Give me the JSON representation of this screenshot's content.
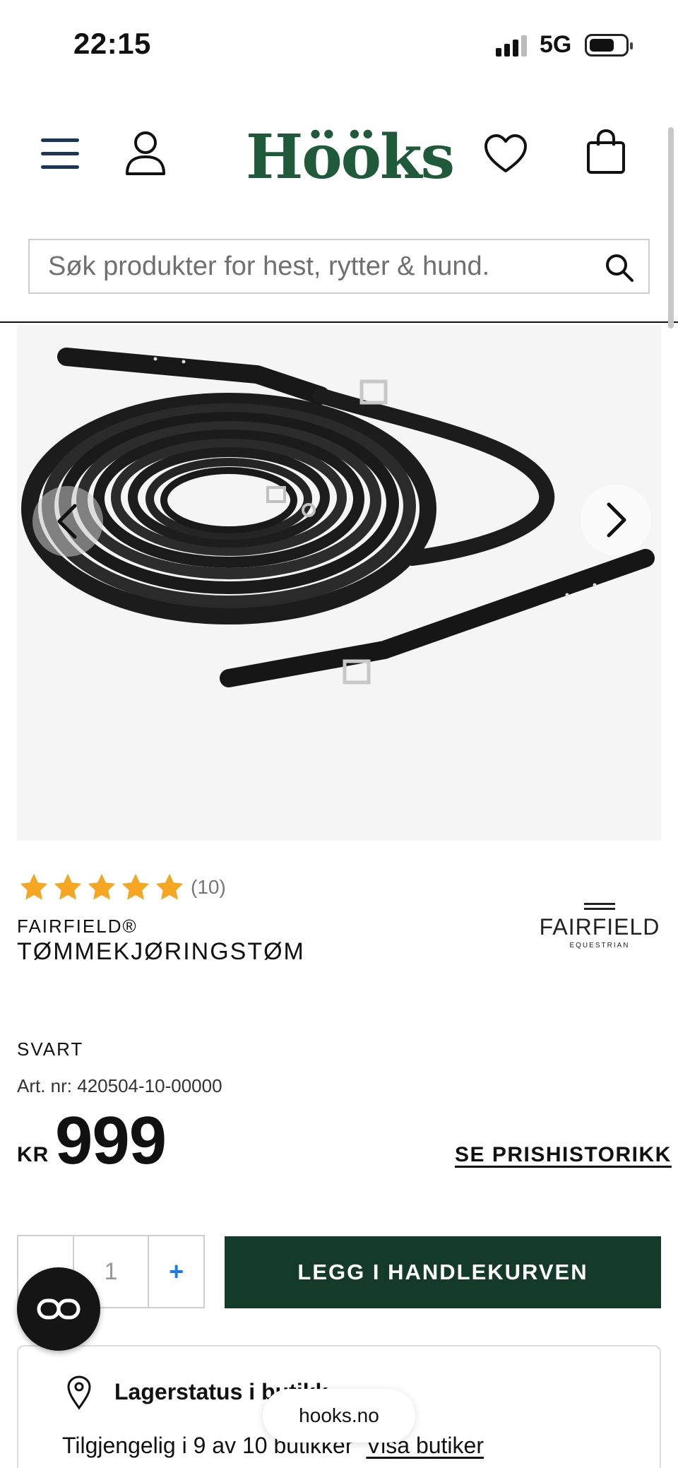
{
  "status_bar": {
    "time": "22:15",
    "network": "5G"
  },
  "header": {
    "logo": "Hööks"
  },
  "search": {
    "placeholder": "Søk produkter for hest, rytter & hund."
  },
  "product": {
    "rating": {
      "stars": 5,
      "count": "(10)"
    },
    "brand": "FAIRFIELD®",
    "name": "TØMMEKJØRINGSTØM",
    "brand_logo": {
      "name": "FAIRFIELD",
      "sub": "EQUESTRIAN"
    },
    "color": "SVART",
    "art_label": "Art. nr:",
    "art_number": "420504-10-00000",
    "currency": "KR",
    "price": "999",
    "price_history": "SE PRISHISTORIKK",
    "quantity": "1",
    "plus_label": "+",
    "add_to_cart": "LEGG I HANDLEKURVEN"
  },
  "stock": {
    "title": "Lagerstatus i butikk",
    "availability": "Tilgjengelig i 9 av 10 butikker",
    "link": "Visa butiker"
  },
  "browser": {
    "url": "hooks.no"
  },
  "colors": {
    "brand_green": "#1f5a3b",
    "cart_button": "#143b2a",
    "star": "#f5a623",
    "plus": "#1a7be0"
  }
}
